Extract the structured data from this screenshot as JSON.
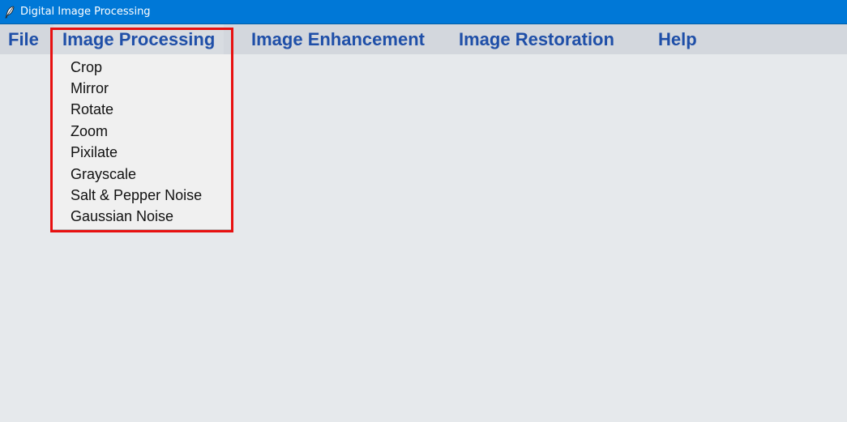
{
  "window": {
    "title": "Digital Image Processing",
    "icon": "feather-icon"
  },
  "menubar": {
    "items": [
      {
        "label": "File"
      },
      {
        "label": "Image Processing"
      },
      {
        "label": "Image Enhancement"
      },
      {
        "label": "Image Restoration"
      },
      {
        "label": "Help"
      }
    ]
  },
  "dropdown": {
    "parent": "Image Processing",
    "items": [
      {
        "label": "Crop"
      },
      {
        "label": "Mirror"
      },
      {
        "label": "Rotate"
      },
      {
        "label": "Zoom"
      },
      {
        "label": "Pixilate"
      },
      {
        "label": "Grayscale"
      },
      {
        "label": "Salt & Pepper Noise"
      },
      {
        "label": "Gaussian Noise"
      }
    ]
  },
  "colors": {
    "titlebar": "#0078d7",
    "menubar": "#d3d7dd",
    "menu_text": "#1f4fa8",
    "dropdown_bg": "#f0f0f0",
    "highlight": "#e81010",
    "client_bg": "#e6e9ec"
  }
}
